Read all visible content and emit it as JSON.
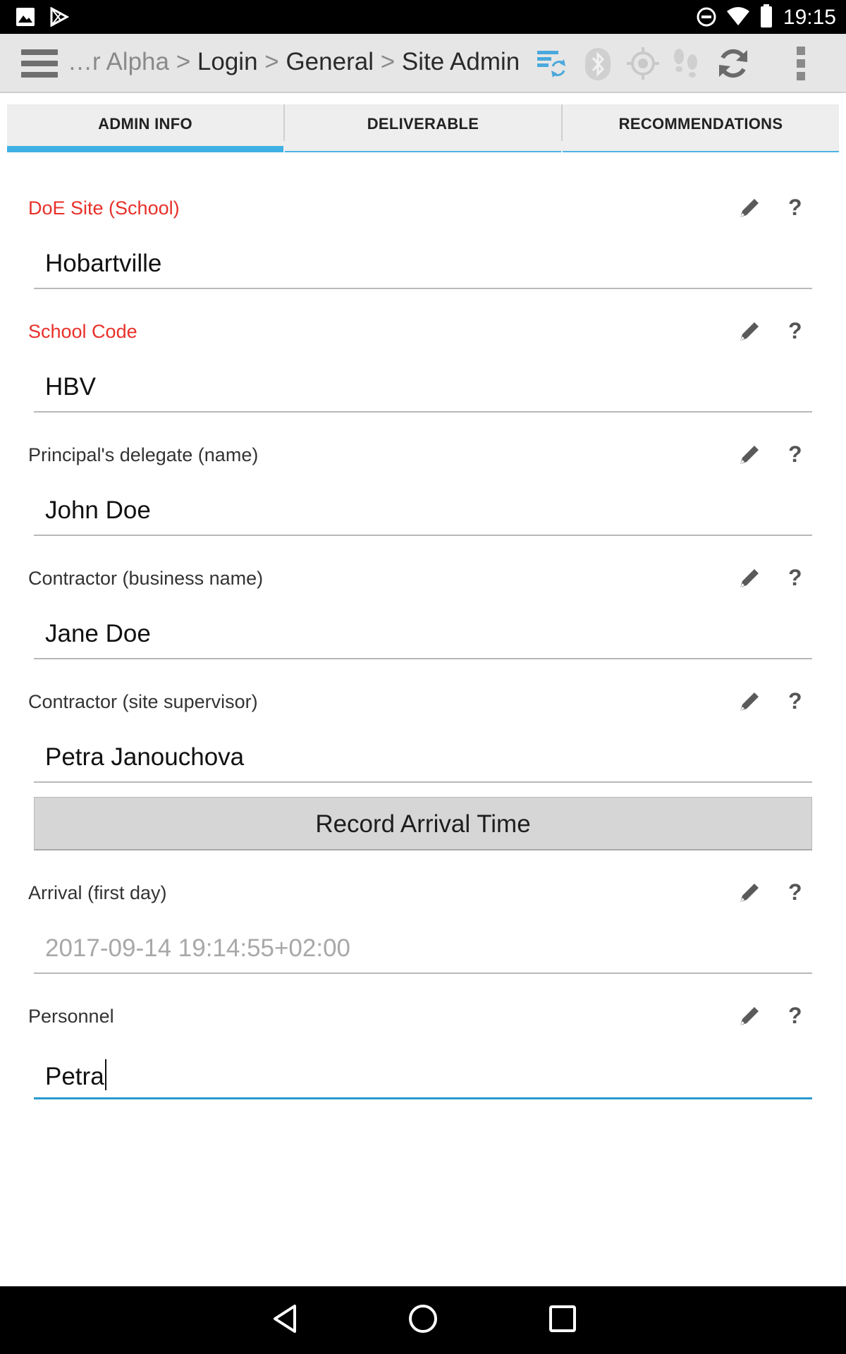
{
  "status_bar": {
    "time": "19:15"
  },
  "action_bar": {
    "breadcrumb": {
      "truncated": "…r Alpha",
      "separator": ">",
      "items": [
        "Login",
        "General",
        "Site Admin"
      ]
    }
  },
  "tabs": [
    {
      "label": "ADMIN INFO",
      "active": true
    },
    {
      "label": "DELIVERABLE",
      "active": false
    },
    {
      "label": "RECOMMENDATIONS",
      "active": false
    }
  ],
  "fields": [
    {
      "label": "DoE Site (School)",
      "value": "Hobartville",
      "required": true
    },
    {
      "label": "School Code",
      "value": "HBV",
      "required": true
    },
    {
      "label": "Principal's delegate (name)",
      "value": "John Doe",
      "required": false
    },
    {
      "label": "Contractor (business name)",
      "value": "Jane Doe",
      "required": false
    },
    {
      "label": "Contractor (site supervisor)",
      "value": "Petra Janouchova",
      "required": false
    },
    {
      "label": "Arrival (first day)",
      "value": "2017-09-14 19:14:55+02:00",
      "required": false
    },
    {
      "label": "Personnel",
      "value": "Petra",
      "required": false
    }
  ],
  "record_arrival_button": "Record Arrival Time",
  "help_glyph": "?",
  "colors": {
    "required_label": "#e8302a",
    "accent": "#3fb0e4"
  }
}
